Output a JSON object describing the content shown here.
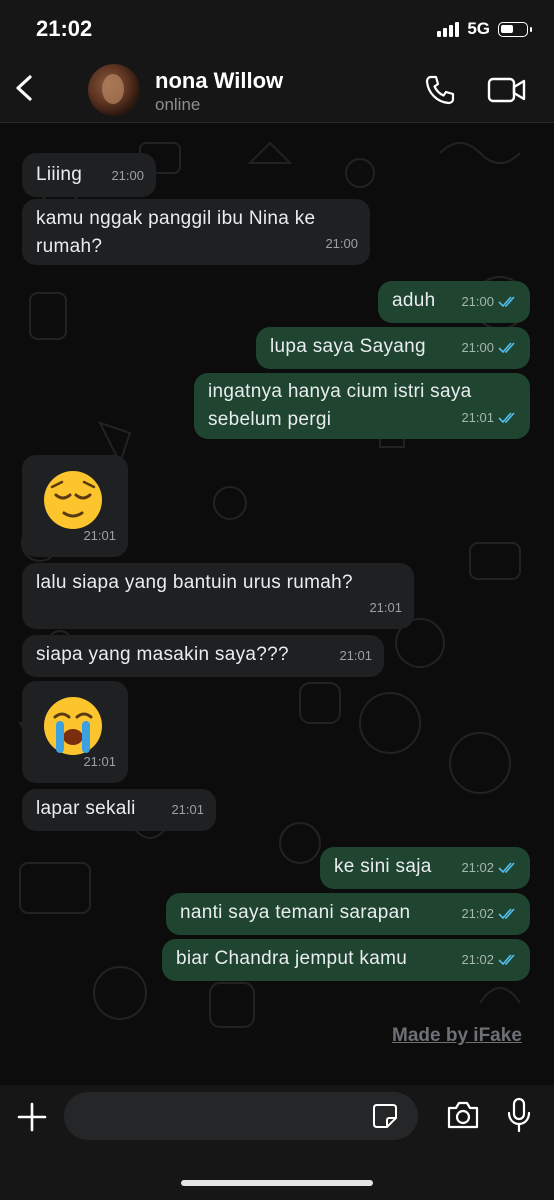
{
  "status_bar": {
    "time": "21:02",
    "network": "5G"
  },
  "header": {
    "contact_name": "nona Willow",
    "contact_status": "online"
  },
  "messages": [
    {
      "text": "Liiing",
      "time": "21:00"
    },
    {
      "text": "kamu nggak panggil ibu Nina ke\nrumah?",
      "time": "21:00"
    },
    {
      "text": "aduh",
      "time": "21:00"
    },
    {
      "text": "lupa saya Sayang",
      "time": "21:00"
    },
    {
      "text": "ingatnya hanya cium istri saya\nsebelum pergi",
      "time": "21:01"
    },
    {
      "emoji": "relieved-face",
      "time": "21:01"
    },
    {
      "text": "lalu siapa yang bantuin urus rumah?",
      "time": "21:01"
    },
    {
      "text": "siapa yang masakin saya???",
      "time": "21:01"
    },
    {
      "emoji": "loudly-crying-face",
      "time": "21:01"
    },
    {
      "text": "lapar sekali",
      "time": "21:01"
    },
    {
      "text": "ke sini saja",
      "time": "21:02"
    },
    {
      "text": "nanti saya temani sarapan",
      "time": "21:02"
    },
    {
      "text": "biar Chandra jemput kamu",
      "time": "21:02"
    }
  ],
  "watermark": "Made by iFake",
  "input": {
    "placeholder": ""
  },
  "colors": {
    "incoming_bubble": "#1f2022",
    "outgoing_bubble": "#1f4430",
    "read_ticks": "#53bdeb"
  }
}
